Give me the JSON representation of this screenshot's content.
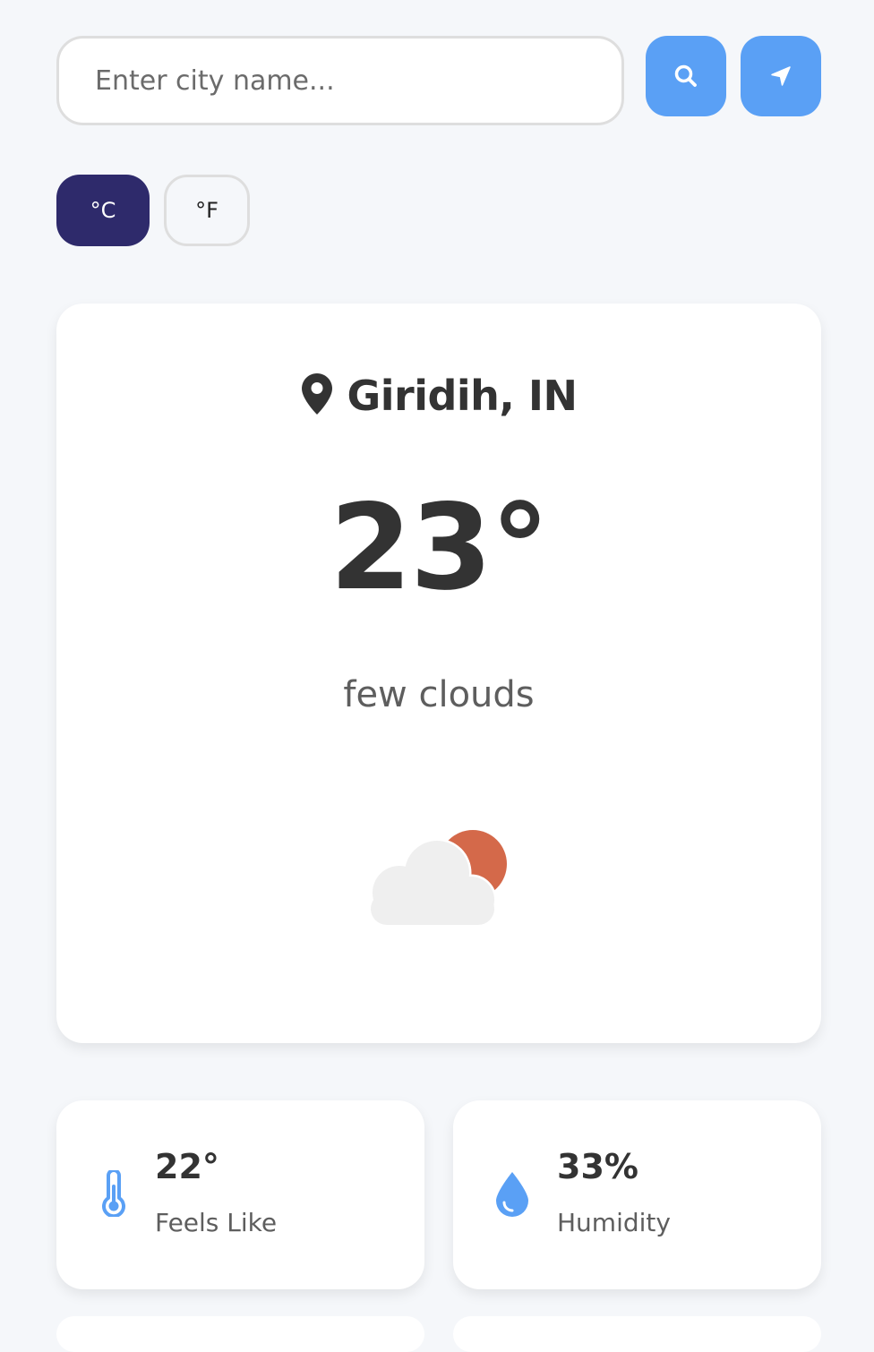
{
  "search": {
    "placeholder": "Enter city name...",
    "value": "",
    "search_icon": "search-icon",
    "locate_icon": "location-arrow-icon"
  },
  "units": {
    "celsius_label": "°C",
    "fahrenheit_label": "°F",
    "selected": "celsius"
  },
  "weather": {
    "location_icon": "map-pin-icon",
    "location": "Giridih, IN",
    "temperature": "23°",
    "description": "few clouds",
    "icon": "few-clouds-day-icon"
  },
  "details": {
    "feels_like": {
      "icon": "thermometer-icon",
      "value": "22°",
      "label": "Feels Like"
    },
    "humidity": {
      "icon": "water-drop-icon",
      "value": "33%",
      "label": "Humidity"
    }
  },
  "colors": {
    "background": "#f5f7fa",
    "accent_blue": "#5aa0f5",
    "unit_active": "#2e2a6b",
    "sun": "#d4694a",
    "cloud": "#efefef",
    "text_dark": "#333333",
    "text_muted": "#5e5e5e"
  }
}
